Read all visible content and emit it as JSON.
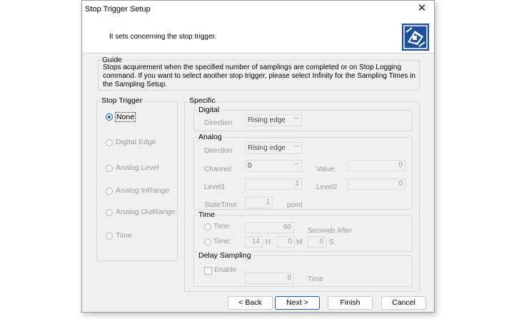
{
  "window": {
    "title": "Stop Trigger Setup",
    "close_glyph": "✕"
  },
  "header": {
    "subtitle": "It sets concerning the stop trigger.",
    "logo_icon": "wizard-logo-icon"
  },
  "guide": {
    "legend": "Guide",
    "text": "Stops acquirement when the specified number of samplings are completed or on Stop Logging command. If you want to select another stop trigger, please select Infinity for the Sampling Times in the Sampling Setup."
  },
  "stop_trigger": {
    "legend": "Stop Trigger",
    "options": [
      "None",
      "Digital Edge",
      "Analog Level",
      "Analog InRange",
      "Analog OutRange",
      "Time"
    ],
    "selected": "None"
  },
  "specific": {
    "legend": "Specific",
    "digital": {
      "legend": "Digital",
      "direction_label": "Direction:",
      "direction_value": "Rising edge"
    },
    "analog": {
      "legend": "Analog",
      "direction_label": "Direction:",
      "direction_value": "Rising edge",
      "channel_label": "Channel:",
      "channel_value": "0",
      "value_label": "Value:",
      "value_value": "0",
      "level1_label": "Level1",
      "level1_value": "1",
      "level2_label": "Level2",
      "level2_value": "0",
      "statetime_label": "StateTime:",
      "statetime_value": "1",
      "statetime_unit": "point"
    },
    "time": {
      "legend": "Time",
      "time1_label": "Time:",
      "time1_value": "60",
      "seconds_after": "Seconds After",
      "time2_label": "Time:",
      "hours_value": "14",
      "h_unit": "H",
      "minutes_value": "0",
      "m_unit": "M",
      "seconds_value": "0",
      "s_unit": "S"
    },
    "delay": {
      "legend": "Delay Sampling",
      "enable_label": "Enable",
      "value": "0",
      "unit": "Time"
    }
  },
  "buttons": {
    "back": "< Back",
    "next": "Next >",
    "finish": "Finish",
    "cancel": "Cancel"
  }
}
